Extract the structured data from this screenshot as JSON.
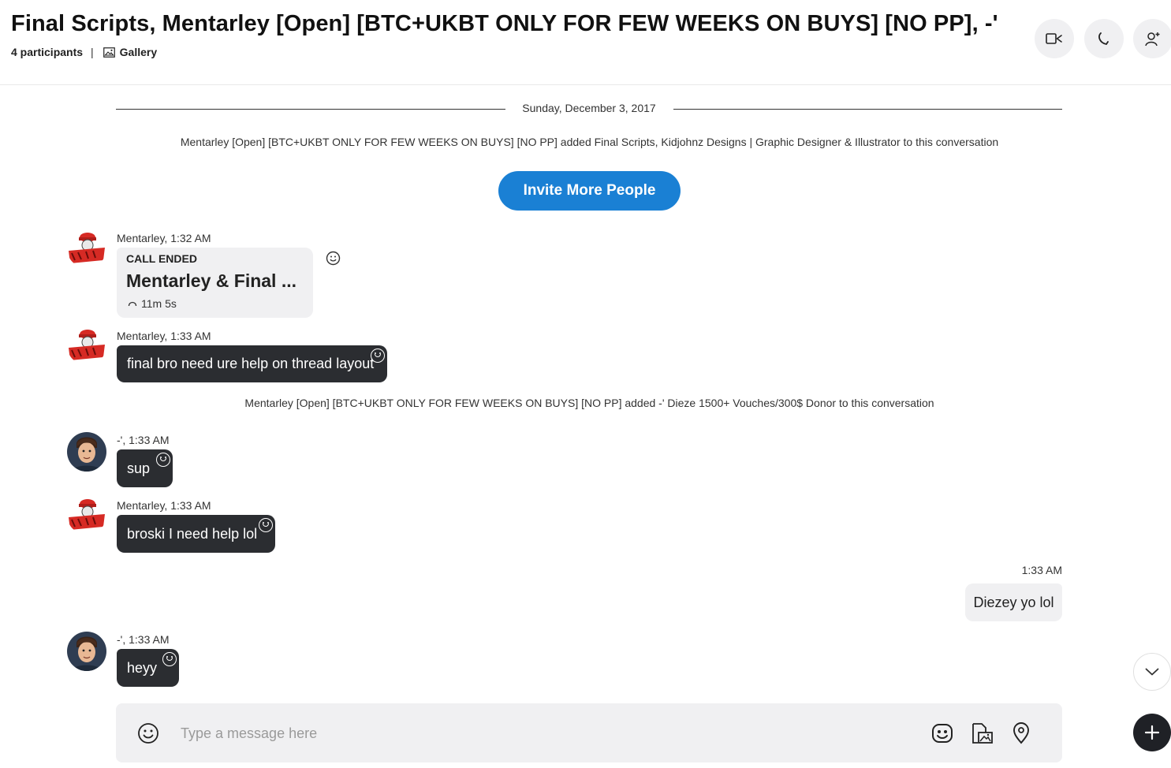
{
  "header": {
    "title": "Final Scripts, Mentarley [Open] [BTC+UKBT ONLY FOR FEW WEEKS ON BUYS] [NO PP], -'",
    "participants": "4 participants",
    "separator": "|",
    "gallery": "Gallery",
    "buttons": [
      "video-call-icon",
      "audio-call-icon",
      "add-person-icon"
    ]
  },
  "conversation": {
    "date": "Sunday, December 3, 2017",
    "system_added_1": "Mentarley [Open] [BTC+UKBT ONLY FOR FEW WEEKS ON BUYS] [NO PP] added Final Scripts, Kidjohnz Designs | Graphic Designer & Illustrator to this conversation",
    "invite_label": "Invite More People",
    "call": {
      "meta": "Mentarley, 1:32 AM",
      "label": "CALL ENDED",
      "participants": "Mentarley & Final ...",
      "duration": "11m 5s"
    },
    "messages": [
      {
        "meta": "Mentarley, 1:33 AM",
        "text": "final bro need ure help on thread layout"
      },
      {
        "meta": "-', 1:33 AM",
        "text": "sup"
      },
      {
        "meta": "Mentarley, 1:33 AM",
        "text": "broski I need help lol"
      },
      {
        "meta": "1:33 AM",
        "text": "Diezey yo lol"
      },
      {
        "meta": "-', 1:33 AM",
        "text": "heyy"
      }
    ],
    "system_added_2": "Mentarley [Open] [BTC+UKBT ONLY FOR FEW WEEKS ON BUYS] [NO PP] added -' Dieze 1500+ Vouches/300$ Donor to this conversation"
  },
  "composer": {
    "placeholder": "Type a message here",
    "icons": [
      "emoji-icon",
      "sticker-icon",
      "media-icon",
      "location-icon",
      "plus-icon"
    ]
  },
  "colors": {
    "accent": "#1a80d4",
    "dark_bubble": "#2b2d31",
    "light_bubble": "#f0f0f2"
  }
}
